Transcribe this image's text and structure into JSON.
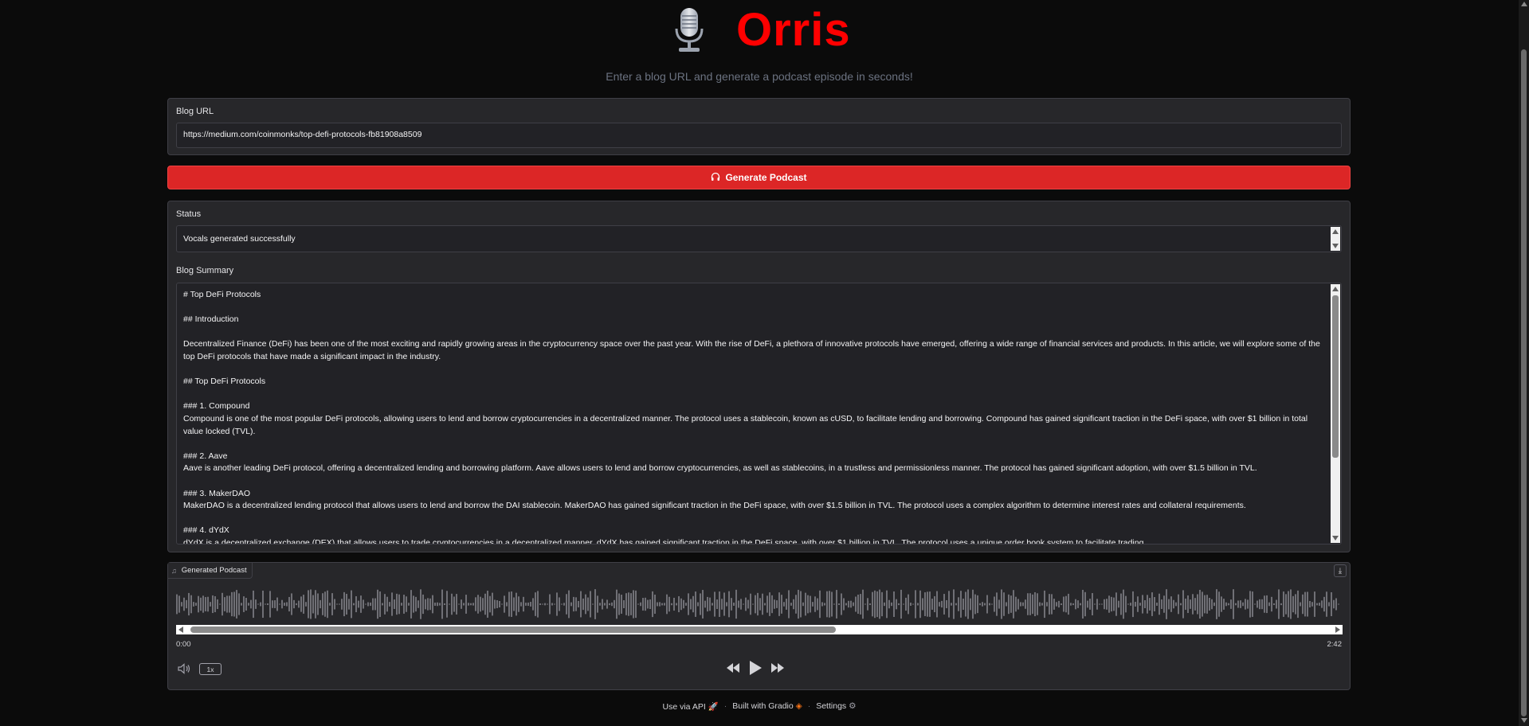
{
  "header": {
    "title": "Orris",
    "subtitle": "Enter a blog URL and generate a podcast episode in seconds!"
  },
  "blog_url": {
    "label": "Blog URL",
    "value": "https://medium.com/coinmonks/top-defi-protocols-fb81908a8509"
  },
  "generate_button": {
    "label": "Generate Podcast",
    "icon": "headphones-icon"
  },
  "status": {
    "label": "Status",
    "value": "Vocals generated successfully"
  },
  "summary": {
    "label": "Blog Summary",
    "lines": [
      "# Top DeFi Protocols",
      "",
      "## Introduction",
      "",
      "Decentralized Finance (DeFi) has been one of the most exciting and rapidly growing areas in the cryptocurrency space over the past year. With the rise of DeFi, a plethora of innovative protocols have emerged, offering a wide range of financial services and products. In this article, we will explore some of the top DeFi protocols that have made a significant impact in the industry.",
      "",
      "## Top DeFi Protocols",
      "",
      "### 1. Compound",
      "Compound is one of the most popular DeFi protocols, allowing users to lend and borrow cryptocurrencies in a decentralized manner. The protocol uses a stablecoin, known as cUSD, to facilitate lending and borrowing. Compound has gained significant traction in the DeFi space, with over $1 billion in total value locked (TVL).",
      "",
      "### 2. Aave",
      "Aave is another leading DeFi protocol, offering a decentralized lending and borrowing platform. Aave allows users to lend and borrow cryptocurrencies, as well as stablecoins, in a trustless and permissionless manner. The protocol has gained significant adoption, with over $1.5 billion in TVL.",
      "",
      "### 3. MakerDAO",
      "MakerDAO is a decentralized lending protocol that allows users to lend and borrow the DAI stablecoin. MakerDAO has gained significant traction in the DeFi space, with over $1.5 billion in TVL. The protocol uses a complex algorithm to determine interest rates and collateral requirements.",
      "",
      "### 4. dYdX",
      "dYdX is a decentralized exchange (DEX) that allows users to trade cryptocurrencies in a decentralized manner. dYdX has gained significant traction in the DeFi space, with over $1 billion in TVL. The protocol uses a unique order book system to facilitate trading."
    ]
  },
  "audio": {
    "label": "Generated Podcast",
    "current_time": "0:00",
    "duration": "2:42",
    "rate": "1x",
    "icons": {
      "note": "music-note-icon",
      "download": "download-icon",
      "volume": "volume-icon",
      "rewind": "rewind-icon",
      "play": "play-icon",
      "forward": "fast-forward-icon"
    }
  },
  "footer": {
    "api": "Use via API",
    "gradio": "Built with Gradio",
    "settings": "Settings"
  },
  "colors": {
    "brand_red": "#ff0000",
    "button_red": "#dc2626",
    "background": "#0b0b0b",
    "panel": "#27272a"
  }
}
